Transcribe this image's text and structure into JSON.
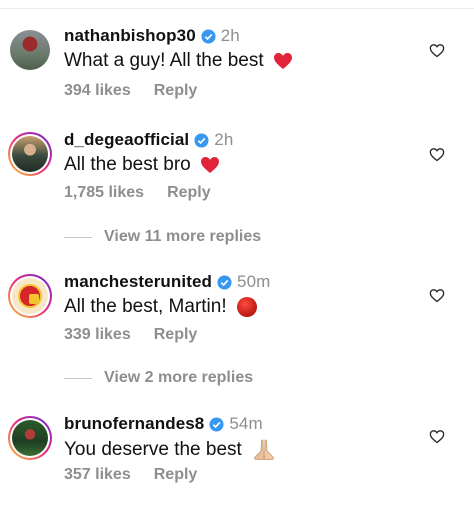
{
  "comments": [
    {
      "username": "nathanbishop30",
      "verified": true,
      "time": "2h",
      "text": "What a guy! All the best",
      "emoji": "red-heart",
      "likes": "394 likes",
      "reply": "Reply"
    },
    {
      "username": "d_degeaofficial",
      "verified": true,
      "time": "2h",
      "text": "All the best bro",
      "emoji": "red-heart",
      "likes": "1,785 likes",
      "reply": "Reply",
      "view_replies": "View 11 more replies"
    },
    {
      "username": "manchesterunited",
      "verified": true,
      "time": "50m",
      "text": "All the best, Martin!",
      "emoji": "red-circle",
      "likes": "339 likes",
      "reply": "Reply",
      "view_replies": "View 2 more replies"
    },
    {
      "username": "brunofernandes8",
      "verified": true,
      "time": "54m",
      "text": "You deserve the best",
      "emoji": "folded-hands",
      "likes": "357 likes",
      "reply": "Reply"
    }
  ],
  "colors": {
    "verified_blue": "#3897f0",
    "heart_red": "#e0243a",
    "muted": "#8e8e8e"
  }
}
